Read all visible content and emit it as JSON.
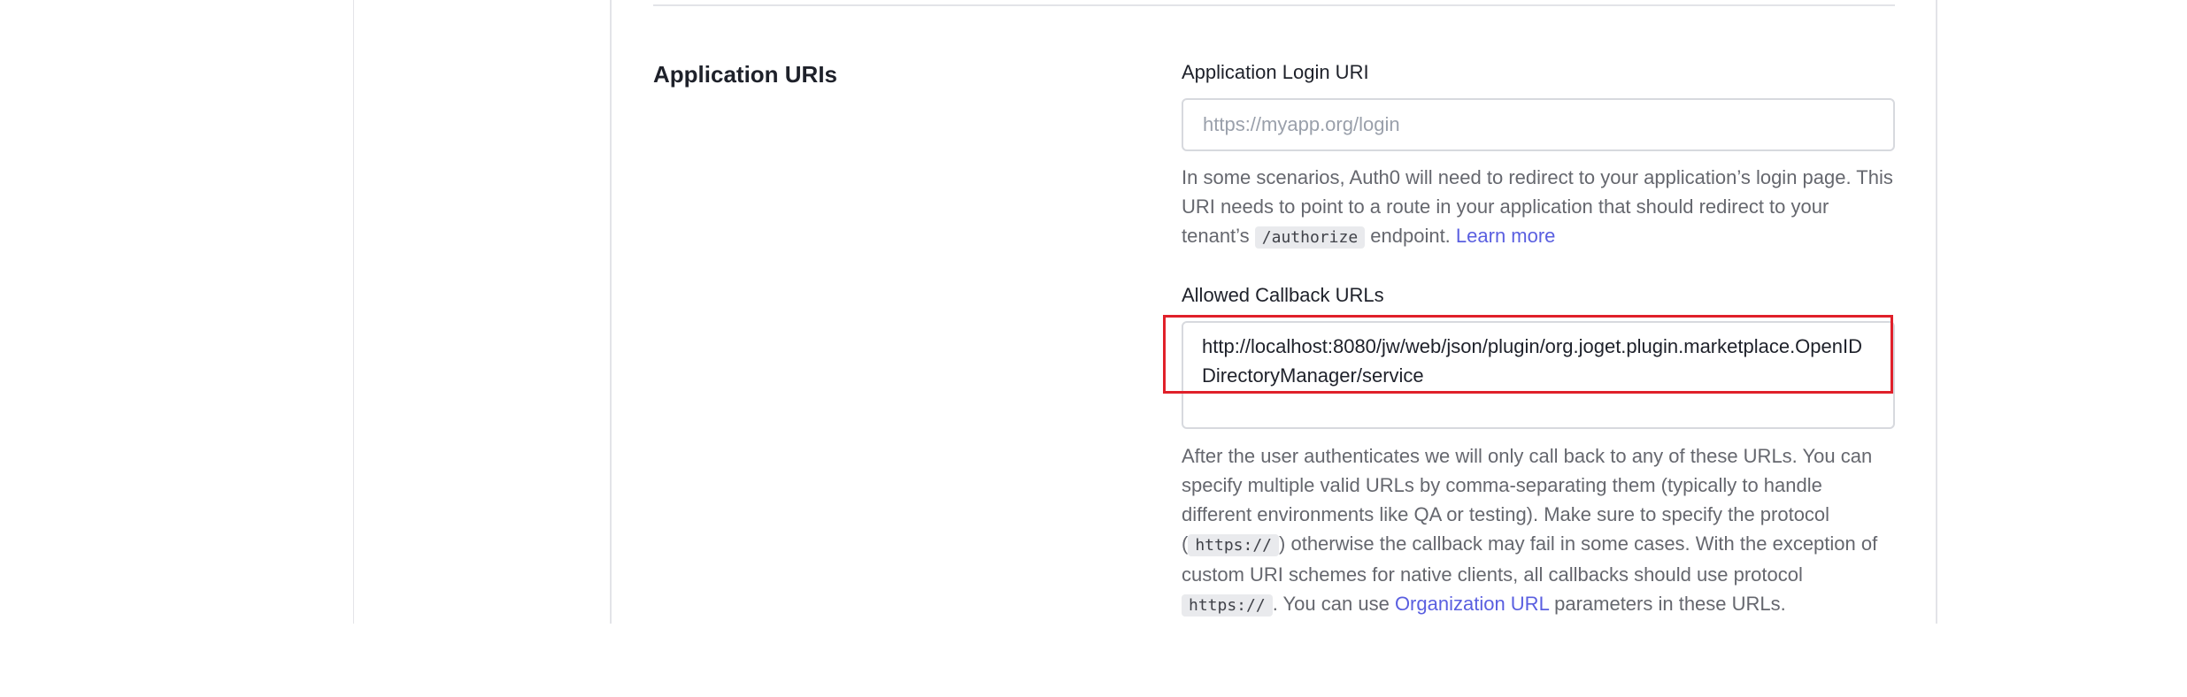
{
  "section": {
    "title": "Application URIs"
  },
  "login_uri": {
    "label": "Application Login URI",
    "placeholder": "https://myapp.org/login",
    "value": "",
    "help": {
      "text1": "In some scenarios, Auth0 will need to redirect to your application’s login page. This URI needs to point to a route in your application that should redirect to your tenant’s ",
      "code": "/authorize",
      "text2": " endpoint. ",
      "link": "Learn more"
    }
  },
  "callback_urls": {
    "label": "Allowed Callback URLs",
    "value": "http://localhost:8080/jw/web/json/plugin/org.joget.plugin.marketplace.OpenIDDirectoryManager/service",
    "help": {
      "text1": "After the user authenticates we will only call back to any of these URLs. You can specify multiple valid URLs by comma-separating them (typically to handle different environments like QA or testing). Make sure to specify the protocol (",
      "code1": "https://",
      "text2": ") otherwise the callback may fail in some cases. With the exception of custom URI schemes for native clients, all callbacks should use protocol ",
      "code2": "https://",
      "text3": ". You can use ",
      "link": "Organization URL",
      "text4": " parameters in these URLs."
    }
  },
  "colors": {
    "link": "#5a5fe0",
    "highlight": "#e0202a",
    "border": "#d7d9de"
  }
}
